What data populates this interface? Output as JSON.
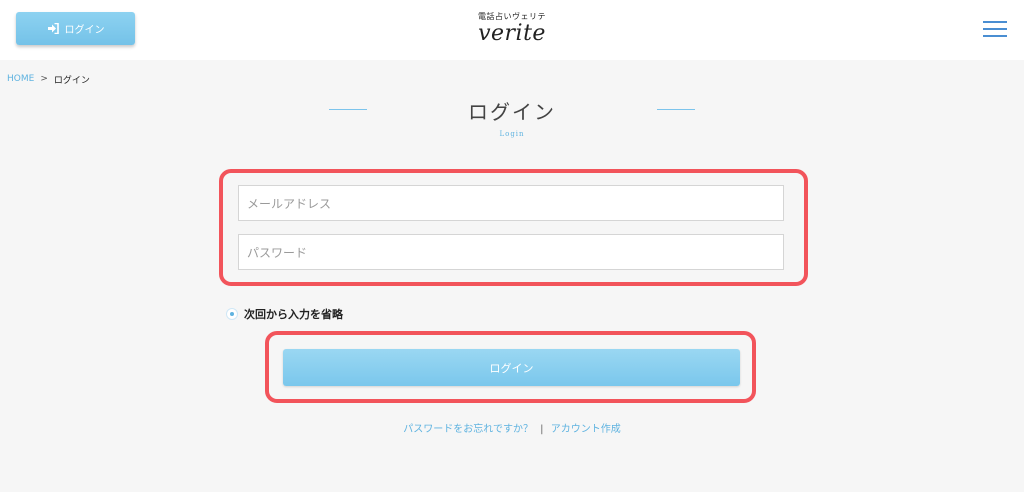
{
  "header": {
    "login_button": {
      "label": "ログイン",
      "icon": "sign-in-icon"
    },
    "logo": {
      "tagline": "電話占いヴェリテ",
      "name": "verite"
    },
    "menu_icon": "hamburger-icon"
  },
  "breadcrumb": {
    "home": "HOME",
    "separator": ">",
    "current": "ログイン"
  },
  "title": {
    "main": "ログイン",
    "sub": "Login"
  },
  "form": {
    "email_placeholder": "メールアドレス",
    "password_placeholder": "パスワード",
    "remember_label": "次回から入力を省略",
    "remember_checked": true,
    "submit_label": "ログイン"
  },
  "links": {
    "forgot_password": "パスワードをお忘れですか？",
    "separator": "|",
    "create_account": "アカウント作成"
  },
  "colors": {
    "accent": "#5fb3e0",
    "button": "#7ac7ec",
    "highlight": "#f2545b",
    "menu": "#4a8ed2"
  }
}
